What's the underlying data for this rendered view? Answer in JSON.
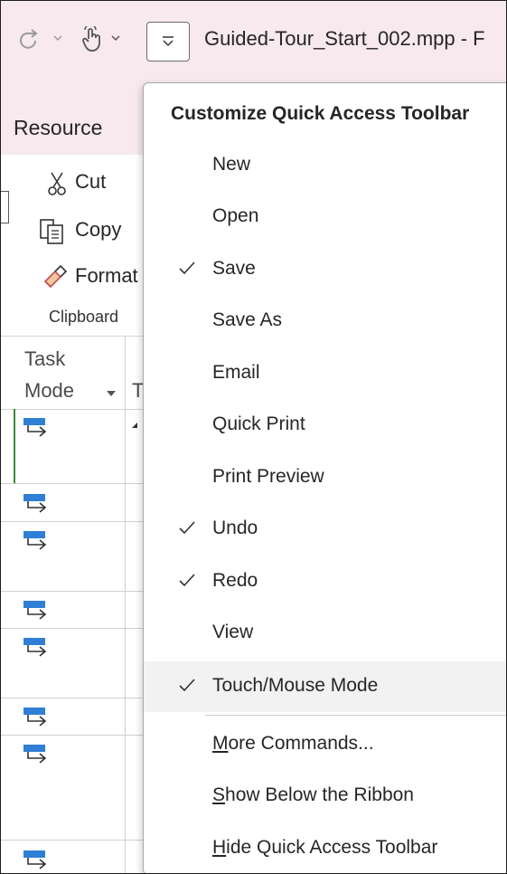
{
  "title_bar": {
    "document_title": "Guided-Tour_Start_002.mpp  -  F",
    "qat_customize_icon": "qat-dropdown-icon",
    "redo_icon": "redo-icon",
    "touch_icon": "touch-mouse-mode-icon"
  },
  "ribbon": {
    "tab_resource": "Resource",
    "cut": "Cut",
    "copy": "Copy",
    "format": "Format",
    "group_label": "Clipboard"
  },
  "grid": {
    "column_header_line1": "Task",
    "column_header_line2": "Mode",
    "next_column_letter": "T"
  },
  "menu": {
    "header": "Customize Quick Access Toolbar",
    "items": [
      {
        "label": "New",
        "checked": false
      },
      {
        "label": "Open",
        "checked": false
      },
      {
        "label": "Save",
        "checked": true
      },
      {
        "label": "Save As",
        "checked": false
      },
      {
        "label": "Email",
        "checked": false
      },
      {
        "label": "Quick Print",
        "checked": false
      },
      {
        "label": "Print Preview",
        "checked": false
      },
      {
        "label": "Undo",
        "checked": true
      },
      {
        "label": "Redo",
        "checked": true
      },
      {
        "label": "View",
        "checked": false
      },
      {
        "label": "Touch/Mouse Mode",
        "checked": true
      }
    ],
    "more_commands": {
      "accel": "M",
      "rest": "ore Commands..."
    },
    "show_below": {
      "accel": "S",
      "rest": "how Below the Ribbon"
    },
    "hide_qat": {
      "accel": "H",
      "rest": "ide Quick Access Toolbar"
    }
  },
  "colors": {
    "titlebar_bg": "#f7e9ee",
    "selection_green": "#3c8a3c",
    "task_mode_icon_blue": "#2f7fd6"
  }
}
